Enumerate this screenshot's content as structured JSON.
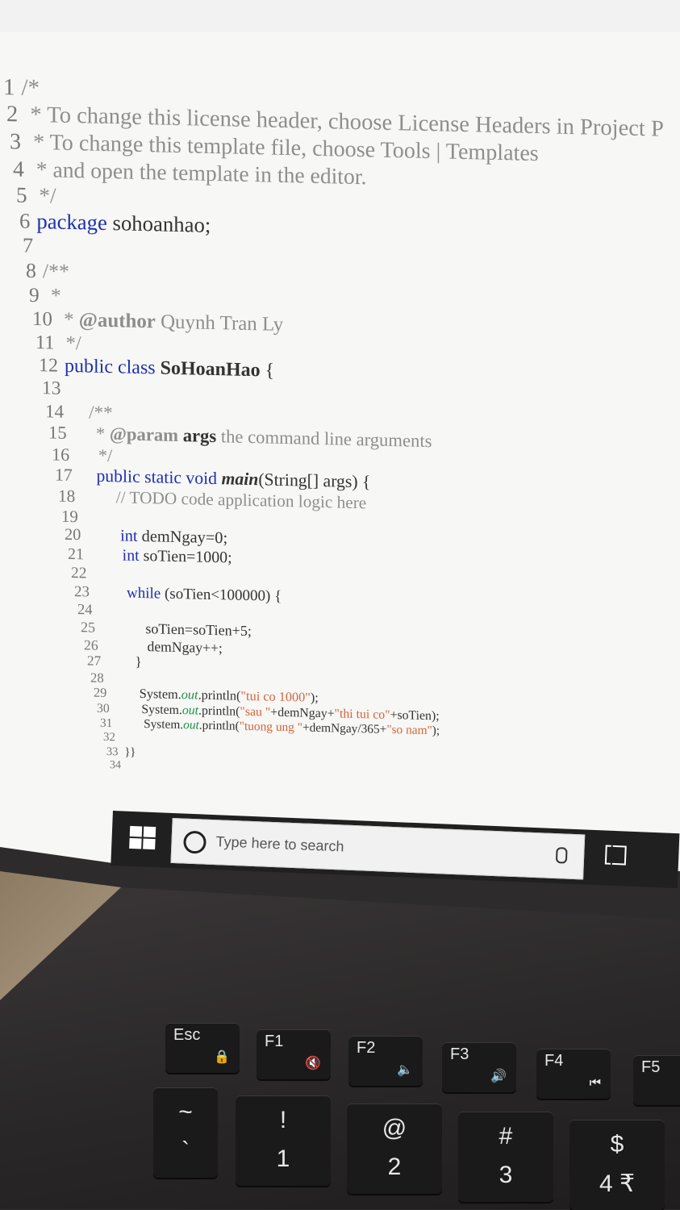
{
  "editor": {
    "lines": [
      {
        "n": "1",
        "segs": [
          {
            "t": "/*",
            "c": "cm"
          }
        ]
      },
      {
        "n": "2",
        "segs": [
          {
            "t": " * To change this license header, choose License Headers in Project P",
            "c": "cm"
          }
        ]
      },
      {
        "n": "3",
        "segs": [
          {
            "t": " * To change this template file, choose Tools | Templates",
            "c": "cm"
          }
        ]
      },
      {
        "n": "4",
        "segs": [
          {
            "t": " * and open the template in the editor.",
            "c": "cm"
          }
        ]
      },
      {
        "n": "5",
        "segs": [
          {
            "t": " */",
            "c": "cm"
          }
        ]
      },
      {
        "n": "6",
        "segs": [
          {
            "t": "package",
            "c": "kw"
          },
          {
            "t": " sohoanhao;",
            "c": ""
          }
        ]
      },
      {
        "n": "7",
        "segs": []
      },
      {
        "n": "8",
        "segs": [
          {
            "t": "/**",
            "c": "cm"
          }
        ]
      },
      {
        "n": "9",
        "segs": [
          {
            "t": " *",
            "c": "cm"
          }
        ]
      },
      {
        "n": "10",
        "segs": [
          {
            "t": " * ",
            "c": "cm"
          },
          {
            "t": "@author",
            "c": "cm b"
          },
          {
            "t": " Quynh Tran Ly",
            "c": "cm"
          }
        ]
      },
      {
        "n": "11",
        "segs": [
          {
            "t": " */",
            "c": "cm"
          }
        ]
      },
      {
        "n": "12",
        "segs": [
          {
            "t": "public class",
            "c": "kw"
          },
          {
            "t": " SoHoanHao",
            "c": "b"
          },
          {
            "t": " {",
            "c": ""
          }
        ]
      },
      {
        "n": "13",
        "segs": []
      },
      {
        "n": "14",
        "segs": [
          {
            "t": "    /**",
            "c": "cm"
          }
        ]
      },
      {
        "n": "15",
        "segs": [
          {
            "t": "     * ",
            "c": "cm"
          },
          {
            "t": "@param",
            "c": "cm b"
          },
          {
            "t": " args",
            "c": "b"
          },
          {
            "t": " the command line arguments",
            "c": "cm"
          }
        ]
      },
      {
        "n": "16",
        "segs": [
          {
            "t": "     */",
            "c": "cm"
          }
        ]
      },
      {
        "n": "17",
        "segs": [
          {
            "t": "    public static void",
            "c": "kw"
          },
          {
            "t": " main",
            "c": "b it"
          },
          {
            "t": "(String[] args) {",
            "c": ""
          }
        ]
      },
      {
        "n": "18",
        "segs": [
          {
            "t": "        // TODO code application logic here",
            "c": "cm"
          }
        ]
      },
      {
        "n": "19",
        "segs": []
      },
      {
        "n": "20",
        "segs": [
          {
            "t": "        int",
            "c": "kw"
          },
          {
            "t": " demNgay=0;",
            "c": ""
          }
        ]
      },
      {
        "n": "21",
        "segs": [
          {
            "t": "        int",
            "c": "kw"
          },
          {
            "t": " soTien=1000;",
            "c": ""
          }
        ]
      },
      {
        "n": "22",
        "segs": []
      },
      {
        "n": "23",
        "segs": [
          {
            "t": "        while",
            "c": "kw"
          },
          {
            "t": " (soTien<100000) {",
            "c": ""
          }
        ]
      },
      {
        "n": "24",
        "segs": []
      },
      {
        "n": "25",
        "segs": [
          {
            "t": "            soTien=soTien+5;",
            "c": ""
          }
        ]
      },
      {
        "n": "26",
        "segs": [
          {
            "t": "            demNgay++;",
            "c": ""
          }
        ]
      },
      {
        "n": "27",
        "segs": [
          {
            "t": "        }",
            "c": ""
          }
        ]
      },
      {
        "n": "28",
        "segs": []
      },
      {
        "n": "29",
        "segs": [
          {
            "t": "        System.",
            "c": ""
          },
          {
            "t": "out",
            "c": "fld"
          },
          {
            "t": ".println(",
            "c": ""
          },
          {
            "t": "\"tui co 1000\"",
            "c": "str"
          },
          {
            "t": ");",
            "c": ""
          }
        ]
      },
      {
        "n": "30",
        "segs": [
          {
            "t": "        System.",
            "c": ""
          },
          {
            "t": "out",
            "c": "fld"
          },
          {
            "t": ".println(",
            "c": ""
          },
          {
            "t": "\"sau \"",
            "c": "str"
          },
          {
            "t": "+demNgay+",
            "c": ""
          },
          {
            "t": "\"thi tui co\"",
            "c": "str"
          },
          {
            "t": "+soTien);",
            "c": ""
          }
        ]
      },
      {
        "n": "31",
        "segs": [
          {
            "t": "        System.",
            "c": ""
          },
          {
            "t": "out",
            "c": "fld"
          },
          {
            "t": ".println(",
            "c": ""
          },
          {
            "t": "\"tuong ung \"",
            "c": "str"
          },
          {
            "t": "+demNgay/365+",
            "c": ""
          },
          {
            "t": "\"so nam\"",
            "c": "str"
          },
          {
            "t": ");",
            "c": ""
          }
        ]
      },
      {
        "n": "32",
        "segs": []
      },
      {
        "n": "33",
        "segs": [
          {
            "t": "}}",
            "c": ""
          }
        ]
      },
      {
        "n": "34",
        "segs": []
      }
    ]
  },
  "taskbar": {
    "search_placeholder": "Type here to search"
  },
  "keyboard": {
    "fn_row": [
      {
        "label": "Esc",
        "sub": "🔒"
      },
      {
        "label": "F1",
        "sub": "🔇"
      },
      {
        "label": "F2",
        "sub": "🔈"
      },
      {
        "label": "F3",
        "sub": "🔊"
      },
      {
        "label": "F4",
        "sub": "⏮"
      },
      {
        "label": "F5",
        "sub": ""
      }
    ],
    "num_row": [
      {
        "top": "~",
        "bottom": "`"
      },
      {
        "top": "!",
        "bottom": "1"
      },
      {
        "top": "@",
        "bottom": "2"
      },
      {
        "top": "#",
        "bottom": "3"
      },
      {
        "top": "$",
        "bottom": "4 ₹"
      }
    ]
  },
  "colors": {
    "keyword": "#1e2fb0",
    "comment": "#8e8e8e",
    "string": "#d4643a",
    "taskbar": "#202020"
  }
}
